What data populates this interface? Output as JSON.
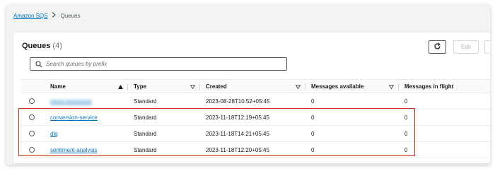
{
  "breadcrumb": {
    "root": "Amazon SQS",
    "current": "Queues"
  },
  "panel": {
    "title": "Queues",
    "count": "(4)"
  },
  "actions": {
    "refresh_icon": "refresh-icon",
    "edit_label": "Edit"
  },
  "search": {
    "placeholder": "Search queues by prefix",
    "value": ""
  },
  "table": {
    "columns": {
      "name": "Name",
      "type": "Type",
      "created": "Created",
      "available": "Messages available",
      "in_flight": "Messages in flight"
    },
    "rows": [
      {
        "name": "xxxxx-xxxxxxxxx",
        "type": "Standard",
        "created": "2023-08-28T10:52+05:45",
        "available": "0",
        "in_flight": "0"
      },
      {
        "name": "conversion-service",
        "type": "Standard",
        "created": "2023-11-18T12:19+05:45",
        "available": "0",
        "in_flight": "0"
      },
      {
        "name": "dlq",
        "type": "Standard",
        "created": "2023-11-18T14:21+05:45",
        "available": "0",
        "in_flight": "0"
      },
      {
        "name": "sentiment-analysis",
        "type": "Standard",
        "created": "2023-11-18T12:20+05:45",
        "available": "0",
        "in_flight": "0"
      }
    ]
  },
  "colors": {
    "link": "#0073bb",
    "highlight": "#d13212",
    "page_bg": "#f2f3f3"
  }
}
